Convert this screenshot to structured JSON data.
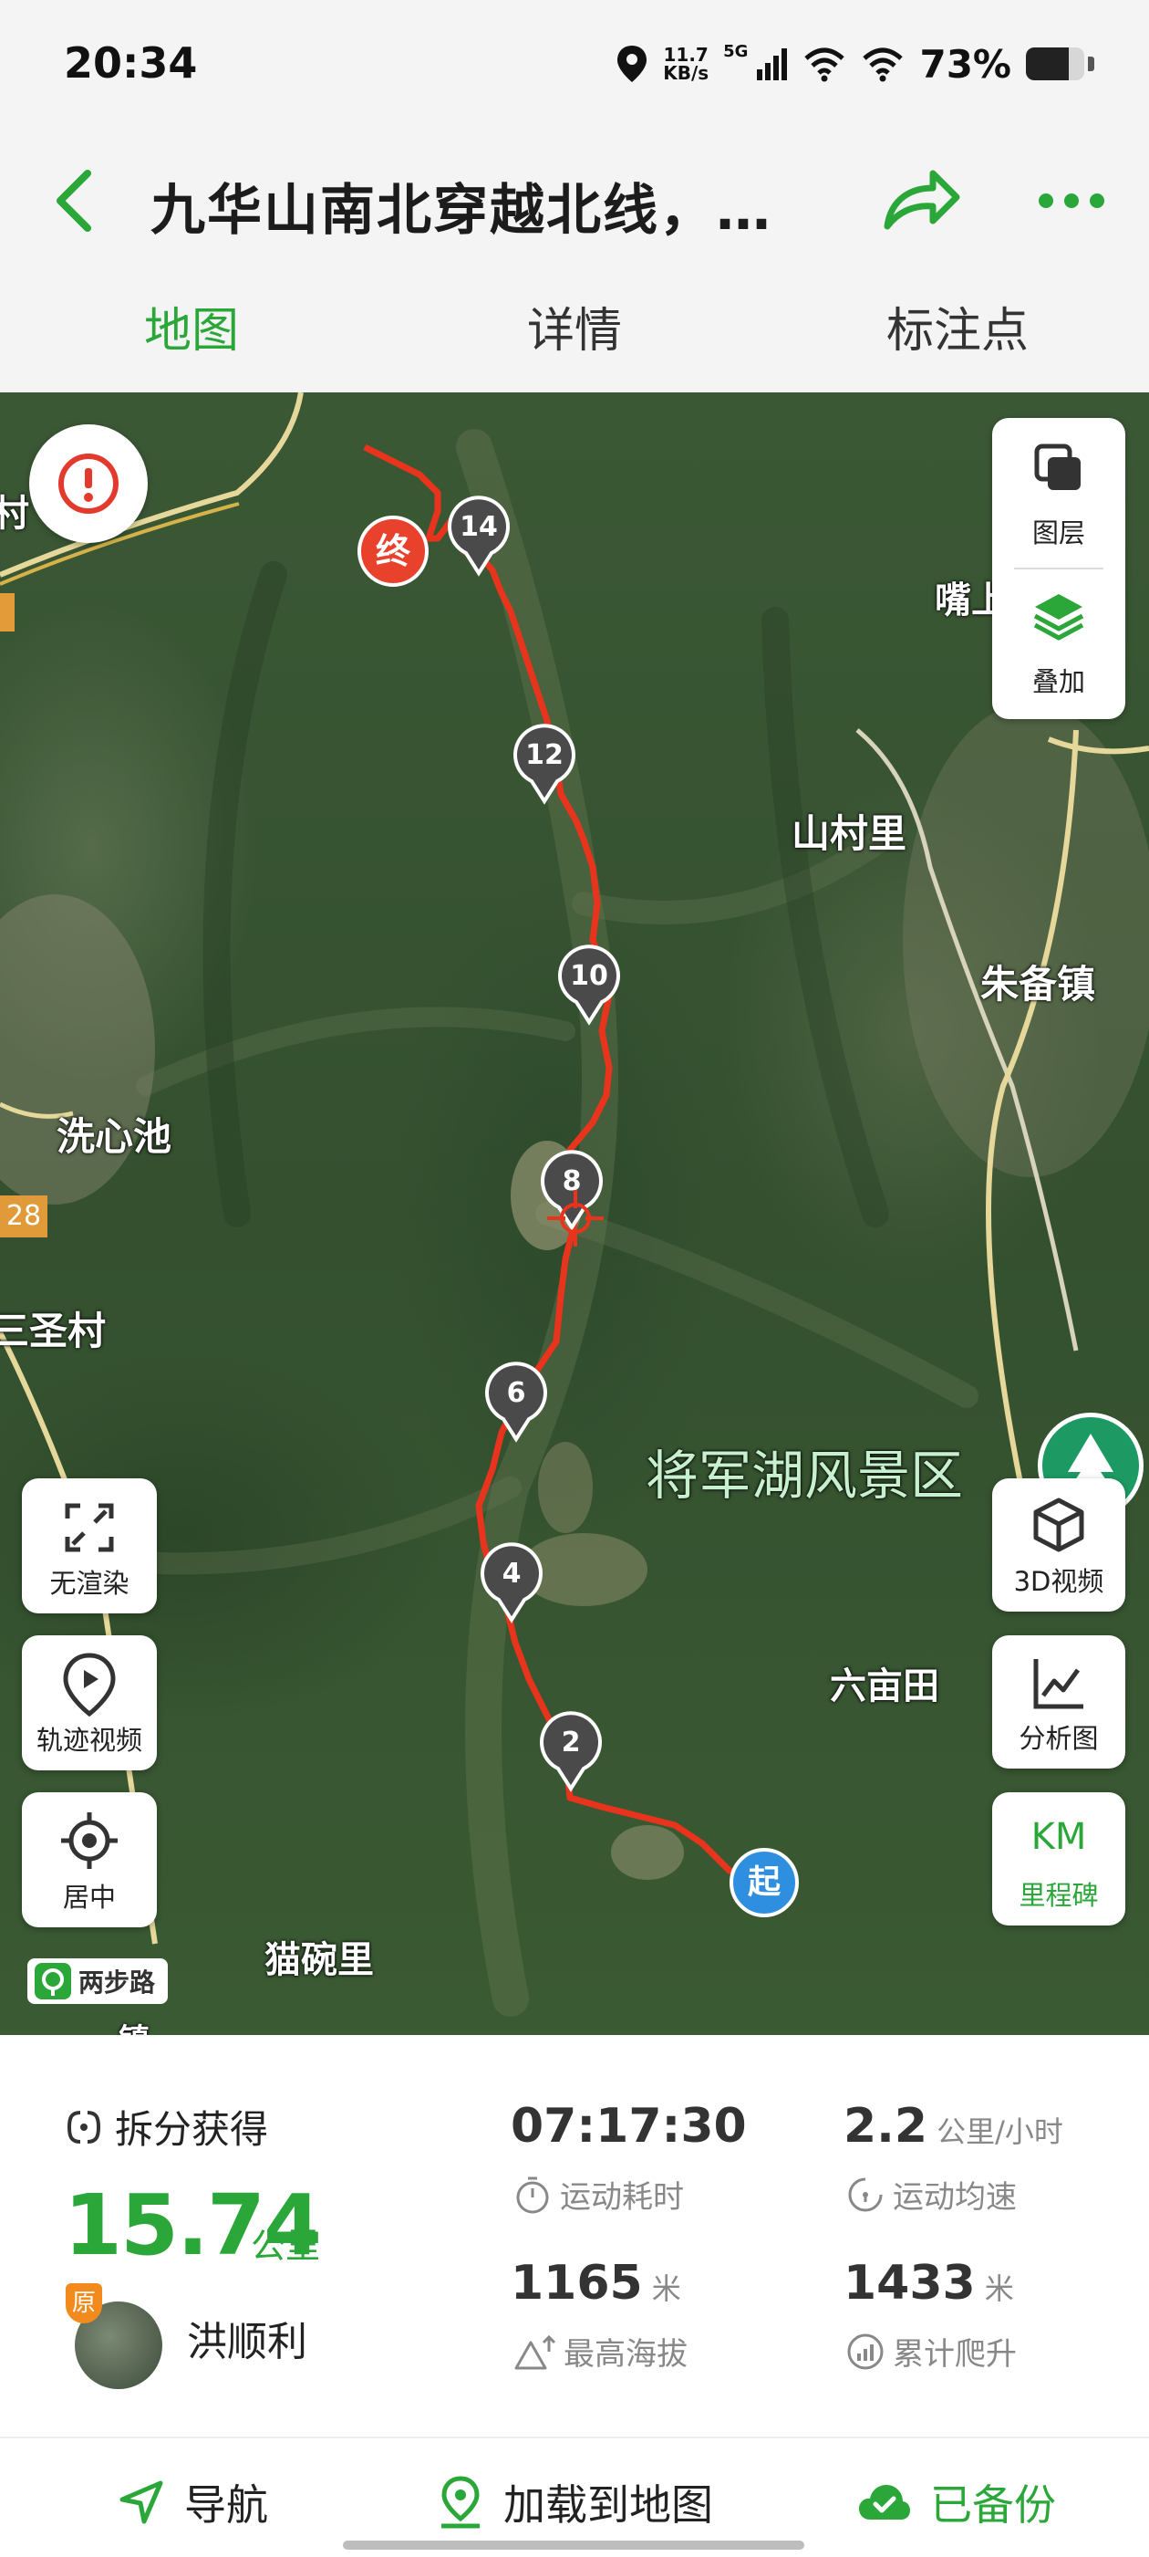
{
  "status_bar": {
    "time": "20:34",
    "net_speed_value": "11.7",
    "net_speed_unit": "KB/s",
    "network_type": "5G",
    "battery_percent": "73%",
    "battery_level": 0.73
  },
  "header": {
    "title": "九华山南北穿越北线，…",
    "back_icon": "chevron-left-icon",
    "share_icon": "share-arrow-icon",
    "more_icon": "more-dots-icon",
    "accent_color": "#2ba73a"
  },
  "tabs": [
    {
      "label": "地图",
      "active": true
    },
    {
      "label": "详情",
      "active": false
    },
    {
      "label": "标注点",
      "active": false
    }
  ],
  "map": {
    "places": {
      "cun": "村",
      "zui": "嘴上",
      "shancunli": "山村里",
      "zhubeizhen": "朱备镇",
      "xixinchi": "洗心池",
      "road_num": "28",
      "sanshengcun": "三圣村",
      "jiangjunhu": "将军湖风景区",
      "liumutian": "六亩田",
      "maowanli": "猫碗里",
      "bottom_cut": "镇"
    },
    "markers": {
      "start": "起",
      "end": "终",
      "km2": "2",
      "km4": "4",
      "km6": "6",
      "km8": "8",
      "km10": "10",
      "km12": "12",
      "km14": "14"
    },
    "watermark": "两步路",
    "controls": {
      "layers": "图层",
      "overlay": "叠加",
      "video3d": "3D视频",
      "analysis": "分析图",
      "milestone_top": "KM",
      "milestone": "里程碑",
      "no_render": "无渲染",
      "track_video": "轨迹视频",
      "center": "居中"
    },
    "route_color": "#e8341c",
    "start_color": "#2e8fe0",
    "end_color": "#e8412c"
  },
  "stats": {
    "split_label": "拆分获得",
    "distance_value": "15.74",
    "distance_unit": "公里",
    "username": "洪顺利",
    "user_badge": "原",
    "duration_value": "07:17:30",
    "duration_label": "运动耗时",
    "speed_value": "2.2",
    "speed_unit": "公里/小时",
    "speed_label": "运动均速",
    "max_alt_value": "1165",
    "max_alt_unit": "米",
    "max_alt_label": "最高海拔",
    "climb_value": "1433",
    "climb_unit": "米",
    "climb_label": "累计爬升"
  },
  "bottom_bar": {
    "navigate": "导航",
    "load_to_map": "加载到地图",
    "backed_up": "已备份"
  }
}
